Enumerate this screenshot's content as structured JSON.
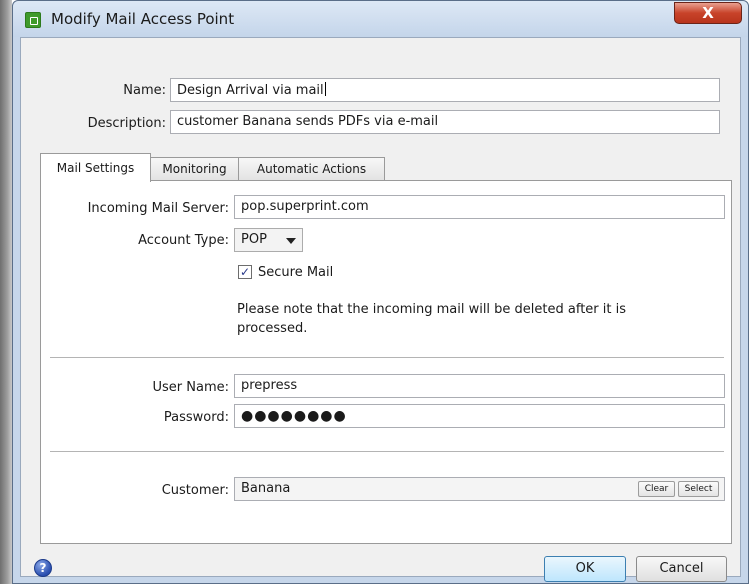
{
  "window": {
    "title": "Modify Mail Access Point",
    "close_label": "X"
  },
  "header_fields": {
    "name_label": "Name:",
    "name_value": "Design Arrival via mail",
    "description_label": "Description:",
    "description_value": "customer Banana sends PDFs via e-mail"
  },
  "tabs": [
    {
      "label": "Mail Settings",
      "active": true
    },
    {
      "label": "Monitoring",
      "active": false
    },
    {
      "label": "Automatic Actions",
      "active": false
    }
  ],
  "mail_settings": {
    "server_label": "Incoming Mail Server:",
    "server_value": "pop.superprint.com",
    "account_type_label": "Account Type:",
    "account_type_value": "POP",
    "secure_mail_label": "Secure Mail",
    "secure_mail_checked": true,
    "note_line1": "Please note that the incoming mail will be deleted after it is",
    "note_line2": "processed.",
    "username_label": "User Name:",
    "username_value": "prepress",
    "password_label": "Password:",
    "password_value": "●●●●●●●●",
    "customer_label": "Customer:",
    "customer_value": "Banana",
    "clear_label": "Clear",
    "select_label": "Select"
  },
  "footer": {
    "help_glyph": "?",
    "ok_label": "OK",
    "cancel_label": "Cancel"
  },
  "colors": {
    "window_frame": "#c6d6ea",
    "dialog_bg": "#f0f0f0",
    "close_button": "#c8432a",
    "app_icon": "#3f9a2b",
    "help_icon": "#2a4fb0"
  },
  "icons": {
    "app": "app-icon",
    "help": "help-icon",
    "dropdown": "chevron-down-icon",
    "check": "checkmark-icon"
  }
}
